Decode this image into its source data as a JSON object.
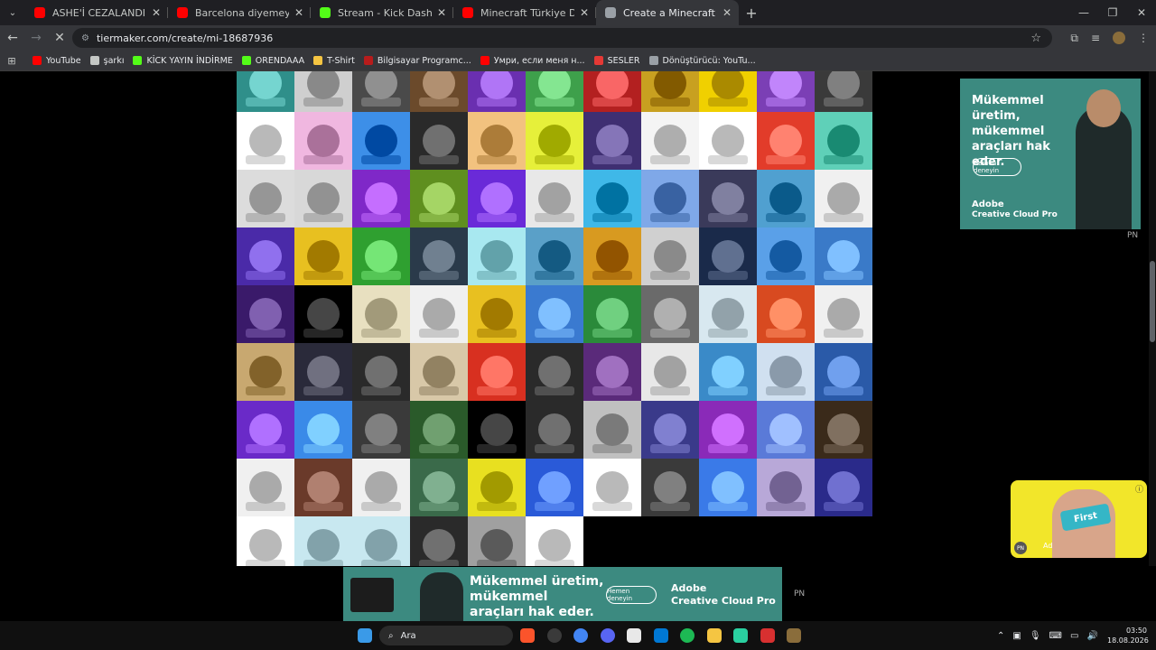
{
  "browser": {
    "tabs": [
      {
        "title": "ASHE'İ CEZALANDIRACAKMIŞ 😂",
        "icon": "youtube-icon",
        "color": "#ff0000",
        "active": false
      },
      {
        "title": "Barcelona diyemeyen spikerin d",
        "icon": "youtube-icon",
        "color": "#ff0000",
        "active": false
      },
      {
        "title": "Stream - Kick Dashboard",
        "icon": "kick-icon",
        "color": "#53fc18",
        "active": false
      },
      {
        "title": "Minecraft Türkiye Dramaları (yu",
        "icon": "youtube-icon",
        "color": "#ff0000",
        "active": false
      },
      {
        "title": "Create a Minecraft Türkiye Yout",
        "icon": "loading-icon",
        "color": "#9aa0a6",
        "active": true
      }
    ],
    "new_tab_label": "+",
    "url": "tiermaker.com/create/mi-18687936",
    "bookmarks": [
      {
        "label": "YouTube",
        "icon": "youtube-icon",
        "color": "#ff0000"
      },
      {
        "label": "şarkı",
        "icon": "music-icon",
        "color": "#c4c7c5"
      },
      {
        "label": "KİCK YAYIN İNDİRME",
        "icon": "kick-icon",
        "color": "#53fc18"
      },
      {
        "label": "ORENDAAA",
        "icon": "kick-icon",
        "color": "#53fc18"
      },
      {
        "label": "T-Shirt",
        "icon": "shirt-icon",
        "color": "#f5c542"
      },
      {
        "label": "Bilgisayar Programc...",
        "icon": "site-icon",
        "color": "#b71c1c"
      },
      {
        "label": "Умри, если меня н...",
        "icon": "youtube-icon",
        "color": "#ff0000"
      },
      {
        "label": "SESLER",
        "icon": "site-icon",
        "color": "#e53935"
      },
      {
        "label": "Dönüştürücü: YouTu...",
        "icon": "convert-icon",
        "color": "#9aa0a6"
      }
    ]
  },
  "tiermaker": {
    "tiles": [
      "#2f8f8a",
      "#cfcfcf",
      "#4a4a4a",
      "#6b4a2b",
      "#6a2fb0",
      "#3ea04b",
      "#b32020",
      "#c8a020",
      "#f0d000",
      "#7b3fb5",
      "#3a3a3a",
      "#ffffff",
      "#f0b7e0",
      "#3d8fe8",
      "#2a2a2a",
      "#f2c27f",
      "#e6f03a",
      "#3f2f72",
      "#f4f4f4",
      "#ffffff",
      "#e23c2a",
      "#5fd0b8",
      "#dcdcdc",
      "#d8d8d8",
      "#7f28c8",
      "#5f8f1f",
      "#6a2ad8",
      "#e8e8e8",
      "#3fb8e8",
      "#7fa8e8",
      "#3a3a5a",
      "#50a0d0",
      "#f0f0f0",
      "#4a2aa8",
      "#e8c020",
      "#2fa030",
      "#2a3a4a",
      "#a8e8f0",
      "#5aa0c8",
      "#d89a20",
      "#d0d0d0",
      "#1a2a4a",
      "#5aa0e8",
      "#3a7ac8",
      "#3a1a6a",
      "#000000",
      "#e8e0c0",
      "#f0f0f0",
      "#e8c020",
      "#3a7ad0",
      "#2a8a3a",
      "#6a6a6a",
      "#d8e8f0",
      "#d84a20",
      "#f0f0f0",
      "#c8a870",
      "#2a2a3a",
      "#2a2a2a",
      "#d8c8a8",
      "#d83020",
      "#2a2a2a",
      "#5a2a7a",
      "#e8e8e8",
      "#3a8ac8",
      "#d0e0f0",
      "#2a5aa8",
      "#6a2ac8",
      "#3a8ae8",
      "#3a3a3a",
      "#2a5a2a",
      "#000000",
      "#2a2a2a",
      "#c0c0c0",
      "#3a3a8a",
      "#8a2ab8",
      "#5a7ad8",
      "#3a2a1a",
      "#f0f0f0",
      "#6a3a2a",
      "#f0f0f0",
      "#3a6a4a",
      "#e8e020",
      "#2a5ad8",
      "#ffffff",
      "#3a3a3a",
      "#3a7ae8",
      "#b8a8d8",
      "#2a2a8a",
      "#ffffff",
      "#c8e8f0",
      "#c8e8f0",
      "#2a2a2a",
      "#a0a0a0",
      "#ffffff"
    ]
  },
  "ads": {
    "side_headline": "Mükemmel üretim, mükemmel araçları hak eder.",
    "side_cta": "Hemen deneyin",
    "brand_name": "Adobe",
    "brand_product": "Creative Cloud Pro",
    "bottom_headline": "Mükemmel üretim, mükemmel araçları hak eder.",
    "bottom_cta": "Hemen deneyin",
    "pn_label": "PN",
    "video_ad_product": "First",
    "video_ad_label": "Ad",
    "video_ad_pn": "PN"
  },
  "taskbar": {
    "search_placeholder": "Ara",
    "time": "03:50",
    "date": "18.08.2026",
    "apps": [
      {
        "icon": "brave-icon",
        "color": "#fb542b"
      },
      {
        "icon": "obs-icon",
        "color": "#3a3a3a"
      },
      {
        "icon": "chrome-icon",
        "color": "#4285f4"
      },
      {
        "icon": "discord-icon",
        "color": "#5865f2"
      },
      {
        "icon": "capcut-icon",
        "color": "#e8e8e8"
      },
      {
        "icon": "store-icon",
        "color": "#0078d4"
      },
      {
        "icon": "spotify-icon",
        "color": "#1db954"
      },
      {
        "icon": "folder-icon",
        "color": "#f5c542"
      },
      {
        "icon": "app-icon",
        "color": "#2ad0a0"
      },
      {
        "icon": "app-red-icon",
        "color": "#d83030"
      },
      {
        "icon": "minecraft-icon",
        "color": "#8a6d3b"
      }
    ]
  },
  "colors": {
    "page_bg": "#000000",
    "ad_teal": "#3c8a80",
    "video_ad_yellow": "#f2e62a"
  }
}
